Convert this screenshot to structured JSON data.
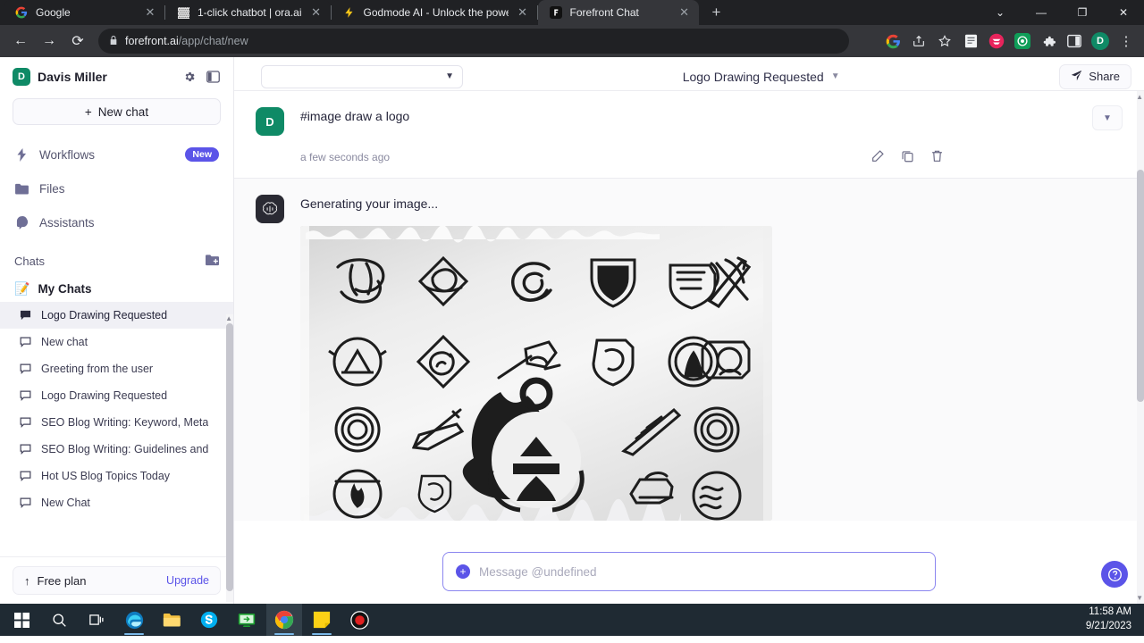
{
  "browser": {
    "tabs": [
      {
        "title": "Google",
        "favicon": "google-icon",
        "active": false
      },
      {
        "title": "1-click chatbot | ora.ai",
        "favicon": "ora-icon",
        "active": false
      },
      {
        "title": "Godmode AI - Unlock the power",
        "favicon": "bolt-icon",
        "active": false
      },
      {
        "title": "Forefront Chat",
        "favicon": "forefront-icon",
        "active": true
      }
    ],
    "new_tab_label": "+",
    "window_controls": {
      "expand": "⌄",
      "minimize": "—",
      "maximize": "❐",
      "close": "✕"
    },
    "nav": {
      "back": "←",
      "forward": "→",
      "reload": "⟳"
    },
    "address": {
      "lock": "🔒",
      "domain": "forefront.ai",
      "path": "/app/chat/new"
    },
    "toolbar_icons": [
      "google-account-icon",
      "share-page-icon",
      "bookmark-star-icon",
      "reading-list-icon",
      "extension-pink-icon",
      "extension-green-icon",
      "extensions-puzzle-icon",
      "side-panel-icon",
      "profile-avatar-icon",
      "chrome-menu-icon"
    ],
    "profile_initial": "D"
  },
  "sidebar": {
    "user": {
      "initial": "D",
      "name": "Davis Miller"
    },
    "header_icons": [
      "settings-gear-icon",
      "collapse-panel-icon"
    ],
    "new_chat_label": "New chat",
    "nav_items": [
      {
        "label": "Workflows",
        "icon": "bolt-icon",
        "badge": "New"
      },
      {
        "label": "Files",
        "icon": "folder-icon",
        "badge": ""
      },
      {
        "label": "Assistants",
        "icon": "assistant-head-icon",
        "badge": ""
      }
    ],
    "chats_title": "Chats",
    "folder": {
      "emoji": "📝",
      "name": "My Chats"
    },
    "chats": [
      {
        "label": "Logo Drawing Requested",
        "active": true
      },
      {
        "label": "New chat",
        "active": false
      },
      {
        "label": "Greeting from the user",
        "active": false
      },
      {
        "label": "Logo Drawing Requested",
        "active": false
      },
      {
        "label": "SEO Blog Writing: Keyword, Meta",
        "active": false
      },
      {
        "label": "SEO Blog Writing: Guidelines and",
        "active": false
      },
      {
        "label": "Hot US Blog Topics Today",
        "active": false
      },
      {
        "label": "New Chat",
        "active": false
      }
    ],
    "footer": {
      "plan_label": "Free plan",
      "upgrade_label": "Upgrade",
      "plan_icon": "arrow-up-icon"
    }
  },
  "main": {
    "model_select_value": "",
    "conversation_title": "Logo Drawing Requested",
    "share_label": "Share",
    "messages": [
      {
        "author_initial": "D",
        "author_type": "user",
        "text": "#image draw a logo",
        "timestamp": "a few seconds ago",
        "actions": [
          "edit-icon",
          "copy-icon",
          "delete-icon"
        ]
      },
      {
        "author_initial": "",
        "author_type": "assistant",
        "text": "Generating your image...",
        "timestamp": "",
        "actions": []
      }
    ],
    "composer": {
      "placeholder": "Message @undefined",
      "value": "",
      "add_label": "+"
    },
    "help_label": "?"
  },
  "taskbar": {
    "items": [
      "windows-start-icon",
      "search-icon",
      "task-view-icon",
      "edge-icon",
      "file-explorer-icon",
      "skype-icon",
      "teamviewer-icon",
      "chrome-icon",
      "sticky-notes-icon",
      "screen-recorder-icon"
    ],
    "clock": {
      "time": "11:58 AM",
      "date": "9/21/2023"
    }
  },
  "colors": {
    "accent": "#5b54e8",
    "user_avatar": "#0f8a66",
    "bot_avatar": "#2a2a33",
    "chrome_bg": "#202124",
    "taskbar_bg": "#1f2a33"
  }
}
